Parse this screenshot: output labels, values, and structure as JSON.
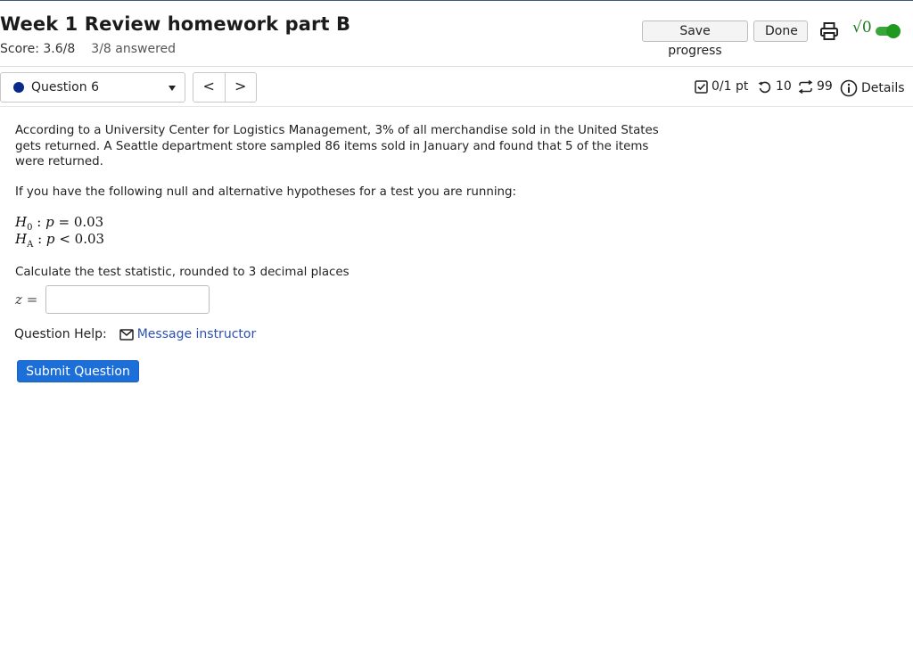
{
  "header": {
    "title": "Week 1 Review homework part B",
    "score": "Score: 3.6/8",
    "answered": "3/8 answered",
    "save_progress_label": "Save progress",
    "done_label": "Done",
    "math_toggle_symbol": "√0",
    "math_toggle_on": true
  },
  "question_nav": {
    "selected_question": "Question 6",
    "status_color": "#0a2a8a",
    "prev_label": "<",
    "next_label": ">"
  },
  "question_meta": {
    "points": "0/1 pt",
    "tries": "10",
    "retries": "99",
    "details_label": "Details"
  },
  "question": {
    "paragraph_1": "According to a University Center for Logistics Management, 3% of all merchandise sold in the United States gets returned. A Seattle department store sampled 86 items sold in January and found that 5 of the items were returned.",
    "paragraph_2": "If you have the following null and alternative hypotheses for a test you are running:",
    "h0": {
      "symbol": "H",
      "sub": "0",
      "param": "p",
      "operator": "=",
      "value": "0.03"
    },
    "ha": {
      "symbol": "H",
      "sub": "A",
      "param": "p",
      "operator": "<",
      "value": "0.03"
    },
    "paragraph_3": "Calculate the test statistic, rounded to 3 decimal places",
    "answer_label": "z",
    "answer_equals": "=",
    "answer_value": ""
  },
  "help": {
    "label": "Question Help:",
    "message_link": "Message instructor"
  },
  "submit_label": "Submit Question",
  "colors": {
    "accent_blue": "#1c6fd8",
    "link_blue": "#2b50b5",
    "toggle_green": "#1f9a1f"
  }
}
